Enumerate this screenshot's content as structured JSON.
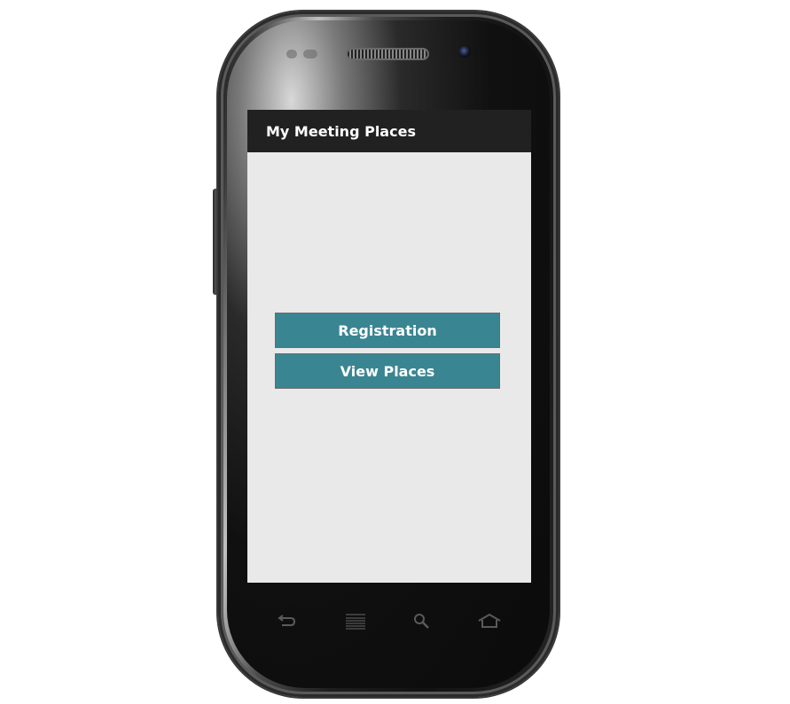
{
  "app": {
    "title": "My Meeting Places"
  },
  "buttons": {
    "registration_label": "Registration",
    "view_places_label": "View Places"
  },
  "softkeys": {
    "back_icon": "back-arrow-icon",
    "menu_icon": "menu-lines-icon",
    "search_icon": "search-icon",
    "home_icon": "home-icon"
  },
  "colors": {
    "action_bar": "#212121",
    "screen_background": "#e9e9e9",
    "button_background": "#3a8592",
    "button_text": "#ffffff"
  }
}
